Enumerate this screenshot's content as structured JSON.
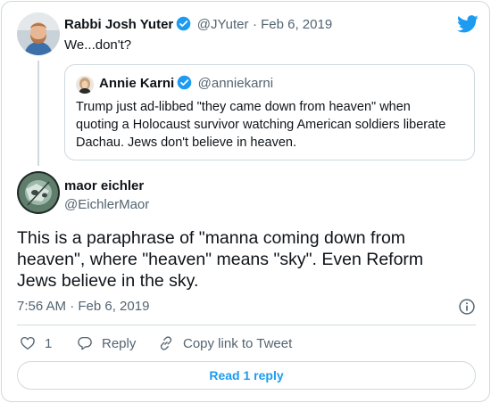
{
  "colors": {
    "brand": "#1d9bf0",
    "text": "#0f1419",
    "muted": "#536471",
    "border": "#cfd9de"
  },
  "icons": [
    "twitter-icon",
    "verified-icon",
    "heart-icon",
    "reply-icon",
    "link-icon",
    "info-icon"
  ],
  "parent_tweet": {
    "name": "Rabbi Josh Yuter",
    "handle": "@JYuter",
    "date": "· Feb 6, 2019",
    "text": "We...don't?",
    "quoted": {
      "name": "Annie Karni",
      "handle": "@anniekarni",
      "text_lines": [
        "Trump just ad-libbed \"they came down from heaven\" when",
        "quoting a Holocaust survivor watching American soldiers liberate",
        "Dachau. Jews don't believe in heaven."
      ]
    }
  },
  "main_tweet": {
    "name": "maor eichler",
    "handle": "@EichlerMaor",
    "text_lines": [
      "This is a paraphrase of \"manna coming down from",
      "heaven\", where \"heaven\" means \"sky\". Even Reform",
      "Jews believe in the sky."
    ],
    "timestamp": "7:56 AM · Feb 6, 2019"
  },
  "actions": {
    "like_count": "1",
    "reply_label": "Reply",
    "copy_label": "Copy link to Tweet"
  },
  "read_replies_label": "Read 1 reply"
}
